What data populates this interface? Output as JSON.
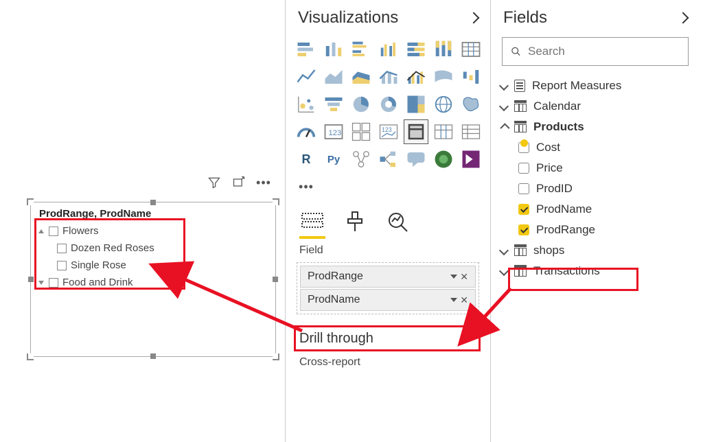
{
  "slicer": {
    "title": "ProdRange, ProdName",
    "items": [
      {
        "label": "Flowers",
        "level": 0,
        "expanded": true
      },
      {
        "label": "Dozen Red Roses",
        "level": 1
      },
      {
        "label": "Single Rose",
        "level": 1
      },
      {
        "label": "Food and Drink",
        "level": 0,
        "expanded": false
      }
    ]
  },
  "viz_panel": {
    "title": "Visualizations",
    "field_section": "Field",
    "wells": [
      {
        "label": "ProdRange"
      },
      {
        "label": "ProdName"
      }
    ],
    "drill_header": "Drill through",
    "cross_report": "Cross-report"
  },
  "fields_panel": {
    "title": "Fields",
    "search_placeholder": "Search",
    "tables": [
      {
        "name": "Report Measures",
        "expanded": false,
        "icon": "report"
      },
      {
        "name": "Calendar",
        "expanded": false,
        "icon": "table"
      },
      {
        "name": "Products",
        "expanded": true,
        "icon": "table",
        "badge": true,
        "fields": [
          {
            "name": "Cost",
            "checked": false
          },
          {
            "name": "Price",
            "checked": false
          },
          {
            "name": "ProdID",
            "checked": false
          },
          {
            "name": "ProdName",
            "checked": true
          },
          {
            "name": "ProdRange",
            "checked": true
          }
        ]
      },
      {
        "name": "shops",
        "expanded": false,
        "icon": "table"
      },
      {
        "name": "Transactions",
        "expanded": false,
        "icon": "table"
      }
    ]
  }
}
